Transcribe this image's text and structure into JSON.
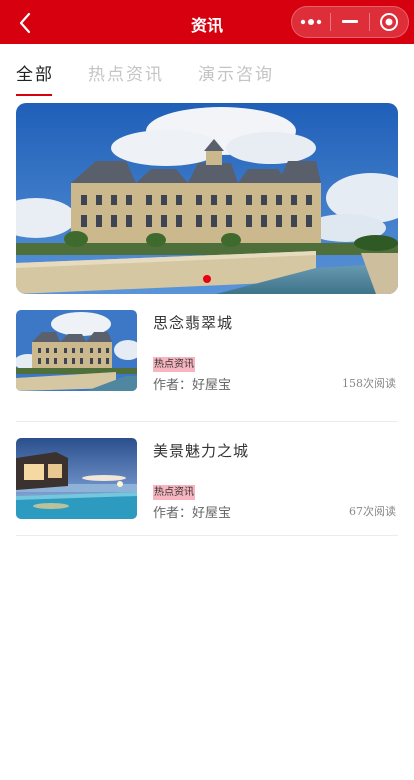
{
  "header": {
    "title": "资讯",
    "back_icon": "chevron-left-icon",
    "more_icon": "more-dots-icon",
    "minimize_icon": "minimize-icon",
    "close_icon": "target-close-icon",
    "bg_color": "#d7000f"
  },
  "tabs": [
    {
      "label": "全部",
      "active": true
    },
    {
      "label": "热点资讯",
      "active": false
    },
    {
      "label": "演示咨询",
      "active": false
    }
  ],
  "banner": {
    "image": "castle-photo",
    "indicator_color": "#e60012"
  },
  "articles": [
    {
      "title": "思念翡翠城",
      "tag": "热点资讯",
      "author": "作者：好屋宝",
      "reads": "158次阅读",
      "image": "castle-thumbnail"
    },
    {
      "title": "美景魅力之城",
      "tag": "热点资讯",
      "author": "作者：好屋宝",
      "reads": "67次阅读",
      "image": "pool-villa-thumbnail"
    }
  ]
}
